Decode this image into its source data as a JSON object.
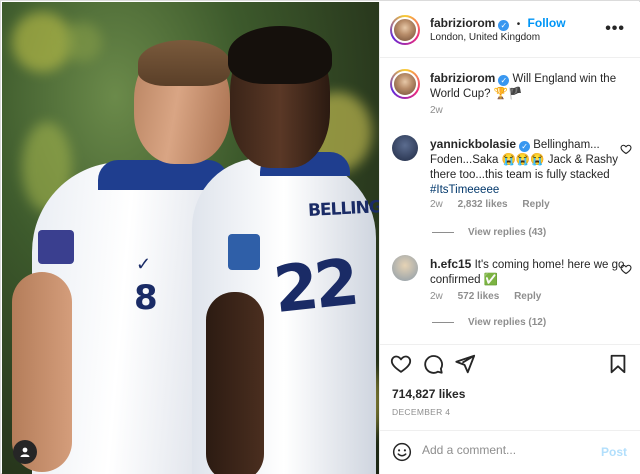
{
  "post": {
    "author": "fabriziorom",
    "follow_label": "Follow",
    "separator": "•",
    "location": "London, United Kingdom",
    "more_label": "•••",
    "caption": "Will England win the World Cup? 🏆🏴",
    "caption_time": "2w",
    "photo": {
      "left_player_number": "8",
      "right_player_number": "22",
      "right_player_name": "BELLINGHAM"
    }
  },
  "comments": [
    {
      "user": "yannickbolasie",
      "verified": true,
      "text_a": "Bellingham... Foden...Saka 😭😭😭 Jack & Rashy there too...this team is fully stacked ",
      "hashtag": "#ItsTimeeeee",
      "time": "2w",
      "likes": "2,832 likes",
      "reply": "Reply",
      "view_replies": "View replies (43)"
    },
    {
      "user": "h.efc15",
      "verified": false,
      "text_a": "It's coming home! here we go confirmed ✅",
      "hashtag": "",
      "time": "2w",
      "likes": "572 likes",
      "reply": "Reply",
      "view_replies": "View replies (12)"
    }
  ],
  "actions": {
    "likes_count": "714,827 likes",
    "date": "DECEMBER 4"
  },
  "add_comment": {
    "placeholder": "Add a comment...",
    "post_label": "Post"
  },
  "colors": {
    "link": "#0095f6",
    "verified": "#3897f0",
    "muted": "#8e8e8e"
  }
}
